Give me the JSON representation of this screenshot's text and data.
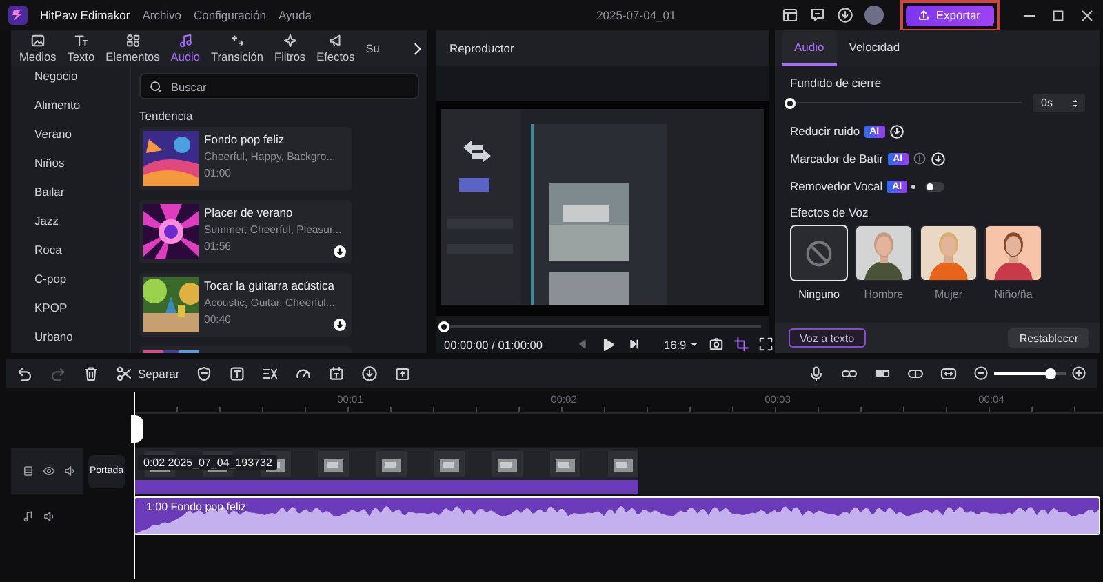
{
  "app": {
    "name": "HitPaw Edimakor",
    "menu": [
      "Archivo",
      "Configuración",
      "Ayuda"
    ],
    "project_title": "2025-07-04_01",
    "export_button": "Exportar"
  },
  "media_tabs": [
    {
      "label": "Medios",
      "selected": false
    },
    {
      "label": "Texto",
      "selected": false
    },
    {
      "label": "Elementos",
      "selected": false
    },
    {
      "label": "Audio",
      "selected": true
    },
    {
      "label": "Transición",
      "selected": false
    },
    {
      "label": "Filtros",
      "selected": false
    },
    {
      "label": "Efectos",
      "selected": false
    },
    {
      "label": "Su",
      "selected": false
    }
  ],
  "categories": [
    "Negocio",
    "Alimento",
    "Verano",
    "Niños",
    "Bailar",
    "Jazz",
    "Roca",
    "C-pop",
    "KPOP",
    "Urbano"
  ],
  "search": {
    "placeholder": "Buscar"
  },
  "section_title": "Tendencia",
  "tracks": [
    {
      "title": "Fondo pop feliz",
      "tags": "Cheerful, Happy, Backgro...",
      "duration": "01:00",
      "downloadable": false
    },
    {
      "title": "Placer de verano",
      "tags": "Summer, Cheerful, Pleasur...",
      "duration": "01:56",
      "downloadable": true
    },
    {
      "title": "Tocar la guitarra acústica",
      "tags": "Acoustic, Guitar, Cheerful...",
      "duration": "00:40",
      "downloadable": true
    }
  ],
  "player": {
    "title": "Reproductor",
    "time": "00:00:00 / 01:00:00",
    "level": 0,
    "aspect": "16:9"
  },
  "properties": {
    "tabs": [
      {
        "label": "Audio",
        "selected": true
      },
      {
        "label": "Velocidad",
        "selected": false
      }
    ],
    "fade_out": {
      "label": "Fundido de cierre",
      "level": 0,
      "value": "0s"
    },
    "features": [
      {
        "kind": "download",
        "label": "Reducir ruido",
        "badge": "AI"
      },
      {
        "kind": "info-download",
        "label": "Marcador de Batir",
        "badge": "AI"
      },
      {
        "kind": "toggle",
        "label": "Removedor Vocal",
        "badge": "AI",
        "on": false
      }
    ],
    "voice_effects": {
      "title": "Efectos de Voz",
      "options": [
        {
          "label": "Ninguno",
          "kind": "none",
          "selected": true
        },
        {
          "label": "Hombre",
          "kind": "man",
          "selected": false
        },
        {
          "label": "Mujer",
          "kind": "woman",
          "selected": false
        },
        {
          "label": "Niño/ña",
          "kind": "child",
          "selected": false
        }
      ]
    },
    "speech_button": "Voz a texto",
    "reset_button": "Restablecer"
  },
  "timeline": {
    "tools": [
      {
        "kind": "undo",
        "disabled": false
      },
      {
        "kind": "redo",
        "disabled": true
      },
      {
        "kind": "delete",
        "disabled": false
      },
      {
        "kind": "split",
        "label": "Separar",
        "disabled": false
      },
      {
        "kind": "shield",
        "disabled": false
      },
      {
        "kind": "text",
        "disabled": false
      },
      {
        "kind": "cut",
        "disabled": false
      },
      {
        "kind": "speed",
        "disabled": false
      },
      {
        "kind": "frame",
        "disabled": false
      },
      {
        "kind": "download",
        "disabled": false
      },
      {
        "kind": "upload",
        "disabled": false
      }
    ],
    "zoom": {
      "level": 0.78
    },
    "ruler": [
      "00:01",
      "00:02",
      "00:03",
      "00:04"
    ],
    "cover_label": "Portada",
    "video_clip": "0:02 2025_07_04_193732",
    "audio_clip": "1:00 Fondo pop feliz"
  }
}
